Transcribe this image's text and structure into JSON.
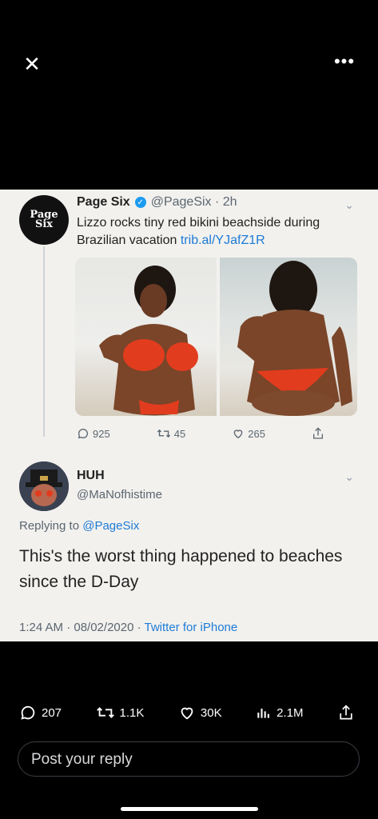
{
  "top_bar": {
    "close_glyph": "✕",
    "more_glyph": "•••"
  },
  "embedded_tweet": {
    "avatar_text": "Page Six",
    "name": "Page Six",
    "handle_time": "@PageSix · 2h",
    "text": "Lizzo rocks tiny red bikini beachside during Brazilian vacation",
    "link": "trib.al/YJafZ1R",
    "actions": {
      "replies": "925",
      "retweets": "45",
      "likes": "265"
    },
    "icons": [
      "reply-icon",
      "retweet-icon",
      "like-icon",
      "share-icon"
    ],
    "colors": {
      "verified": "#1d9bf0",
      "link": "#1d7bd6"
    }
  },
  "reply_tweet": {
    "name": "HUH",
    "handle": "@MaNofhistime",
    "replying_label": "Replying to",
    "replying_mention": "@PageSix",
    "text": "This's the worst thing happened to beaches since the D-Day",
    "time_date": "1:24 AM · 08/02/2020 ·",
    "client": "Twitter for iPhone"
  },
  "bottom_actions": {
    "replies": "207",
    "retweets": "1.1K",
    "likes": "30K",
    "views": "2.1M"
  },
  "reply_box": {
    "placeholder": "Post your reply"
  }
}
